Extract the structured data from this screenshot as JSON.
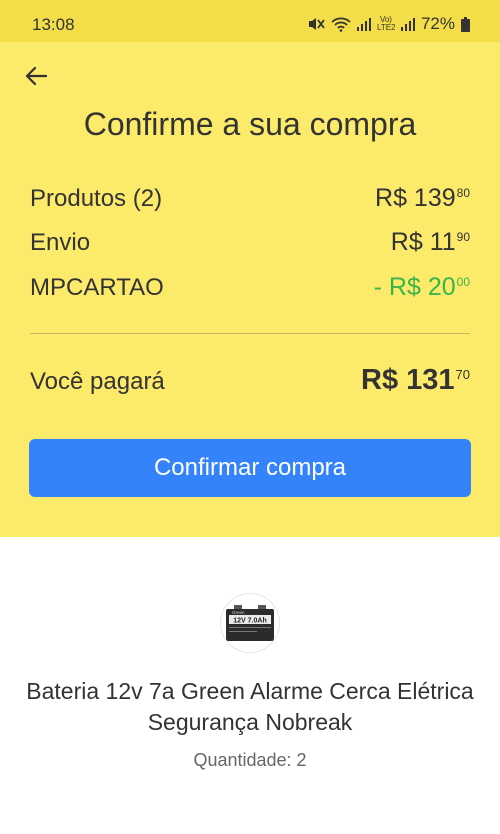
{
  "status_bar": {
    "time": "13:08",
    "battery": "72%",
    "network_label": "Vo) LTE2",
    "icons": [
      "mute-icon",
      "wifi-icon",
      "signal-icon",
      "volte-icon",
      "signal-icon",
      "battery-icon"
    ]
  },
  "header": {
    "back_icon": "arrow-left-icon",
    "title": "Confirme a sua compra"
  },
  "summary": {
    "products": {
      "label": "Produtos (2)",
      "currency": "R$ ",
      "whole": "139",
      "cents": "80"
    },
    "shipping": {
      "label": "Envio",
      "currency": "R$ ",
      "whole": "11",
      "cents": "90"
    },
    "coupon": {
      "label": "MPCARTAO",
      "currency": "- R$ ",
      "whole": "20",
      "cents": "00",
      "color": "#39b54a"
    },
    "total": {
      "label": "Você pagará",
      "currency": "R$ ",
      "whole": "131",
      "cents": "70"
    }
  },
  "confirm_button": {
    "label": "Confirmar compra",
    "color": "#3483fa"
  },
  "product": {
    "image_text": "12V 7.0Ah",
    "brand_text": "Green",
    "title": "Bateria 12v 7a Green Alarme Cerca Elétrica Segurança Nobreak",
    "quantity": "Quantidade: 2"
  },
  "colors": {
    "header_bg": "#fcea6a",
    "status_bg": "#f3de49",
    "text": "#333333"
  }
}
